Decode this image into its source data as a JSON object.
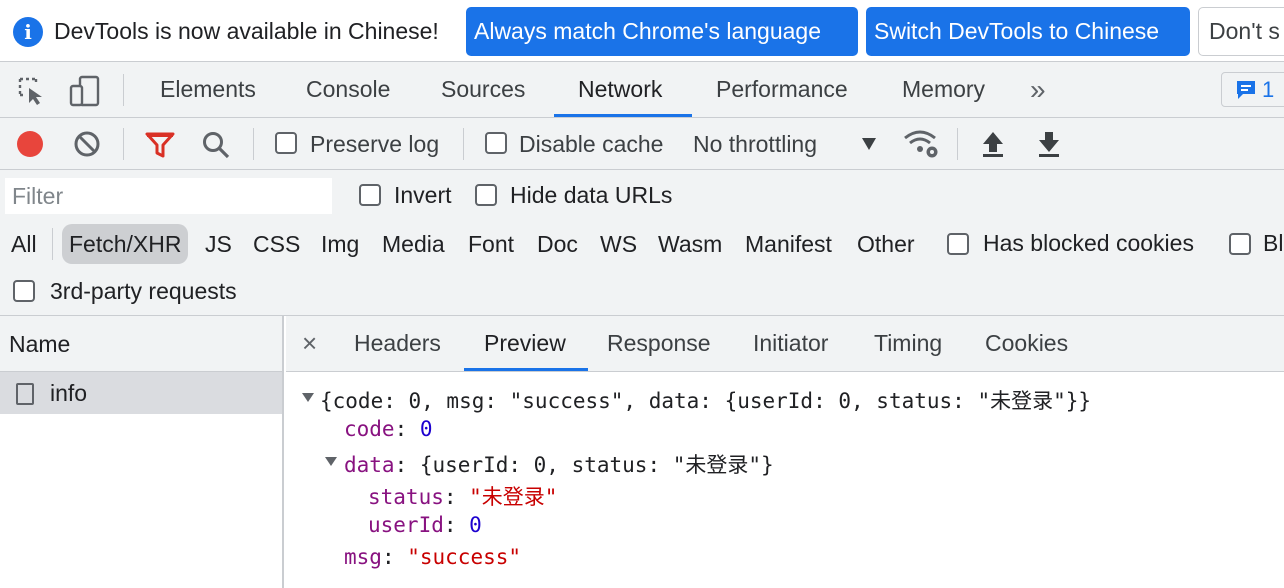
{
  "infobar": {
    "message": "DevTools is now available in Chinese!",
    "match_button": "Always match Chrome's language",
    "switch_button": "Switch DevTools to Chinese",
    "dismiss_button": "Don't s"
  },
  "tabs": {
    "elements": "Elements",
    "console": "Console",
    "sources": "Sources",
    "network": "Network",
    "performance": "Performance",
    "memory": "Memory",
    "more": "»",
    "issues_count": "1"
  },
  "toolbar": {
    "preserve_log": "Preserve log",
    "disable_cache": "Disable cache",
    "throttling": "No throttling"
  },
  "filter": {
    "placeholder": "Filter",
    "invert": "Invert",
    "hide_data_urls": "Hide data URLs",
    "types": [
      "All",
      "Fetch/XHR",
      "JS",
      "CSS",
      "Img",
      "Media",
      "Font",
      "Doc",
      "WS",
      "Wasm",
      "Manifest",
      "Other"
    ],
    "active_type": "Fetch/XHR",
    "has_blocked_cookies": "Has blocked cookies",
    "blocked_requests": "Bl",
    "third_party": "3rd-party requests"
  },
  "request_list": {
    "header": "Name",
    "rows": [
      {
        "name": "info"
      }
    ]
  },
  "detail": {
    "close": "×",
    "tabs": [
      "Headers",
      "Preview",
      "Response",
      "Initiator",
      "Timing",
      "Cookies"
    ],
    "active_tab": "Preview"
  },
  "preview": {
    "summary": "{code: 0, msg: \"success\", data: {userId: 0, status: \"未登录\"}}",
    "code_key": "code",
    "code_value": "0",
    "data_key": "data",
    "data_summary": "{userId: 0, status: \"未登录\"}",
    "status_key": "status",
    "status_value": "\"未登录\"",
    "userid_key": "userId",
    "userid_value": "0",
    "msg_key": "msg",
    "msg_value": "\"success\""
  },
  "colors": {
    "accent": "#1a73e8",
    "record": "#e8453c",
    "filter_active": "#d93025"
  }
}
